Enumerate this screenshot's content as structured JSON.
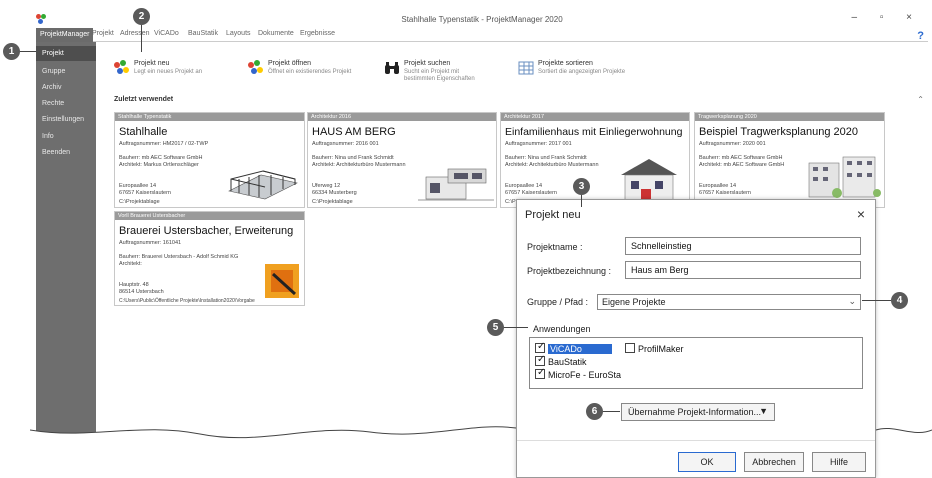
{
  "window": {
    "title": "Stahlhalle Typenstatik - ProjektManager 2020",
    "help": "?"
  },
  "ribbon": {
    "tabs": [
      "ProjektManager",
      "Projekt",
      "Adressen",
      "ViCADo",
      "BauStatik",
      "Layouts",
      "Dokumente",
      "Ergebnisse"
    ]
  },
  "sidebar": {
    "items": [
      "Projekt",
      "Gruppe",
      "Archiv",
      "Rechte",
      "Einstellungen",
      "Info",
      "Beenden"
    ]
  },
  "actions": [
    {
      "label": "Projekt neu",
      "sub": "Legt ein neues Projekt an"
    },
    {
      "label": "Projekt öffnen",
      "sub": "Öffnet ein existierendes Projekt"
    },
    {
      "label": "Projekt suchen",
      "sub": "Sucht ein Projekt mit bestimmten Eigenschaften"
    },
    {
      "label": "Projekte sortieren",
      "sub": "Sortiert die angezeigten Projekte"
    }
  ],
  "recent_header": "Zuletzt verwendet",
  "cards": [
    {
      "cap": "Stahlhalle Typenstatik",
      "name": "Stahlhalle",
      "num": "Auftragsnummer: HM2017 / 02-TWP",
      "l1": "Bauherr:   mb AEC Software GmbH",
      "l2": "Architekt:  Markus Ortlenschläger",
      "l3": "Europaallee 14",
      "l4": "67657 Kaiserslautern",
      "l5": "C:\\Projektablage"
    },
    {
      "cap": "Architektur 2016",
      "name": "HAUS AM BERG",
      "num": "Auftragsnummer: 2016 001",
      "l1": "Bauherr:   Nina und Frank Schmidt",
      "l2": "Architekt:  Architekturbüro Mustermann",
      "l3": "Uferweg 12",
      "l4": "66334 Musterberg",
      "l5": "C:\\Projektablage"
    },
    {
      "cap": "Architektur 2017",
      "name": "Einfamilienhaus mit Einliegerwohnung",
      "num": "Auftragsnummer: 2017 001",
      "l1": "Bauherr:   Nina und Frank Schmidt",
      "l2": "Architekt:  Architekturbüro Mustermann",
      "l3": "Europaallee 14",
      "l4": "67657 Kaiserslautern",
      "l5": "C:\\Projektablage"
    },
    {
      "cap": "Tragwerksplanung 2020",
      "name": "Beispiel Tragwerksplanung 2020",
      "num": "Auftragsnummer: 2020 001",
      "l1": "Bauherr:   mb AEC Software GmbH",
      "l2": "Architekt:  mb AEC Software GmbH",
      "l3": "Europaallee 14",
      "l4": "67657 Kaiserslautern",
      "l5": ""
    },
    {
      "cap": "Vorll Brauerei Ustersbacher",
      "name": "Brauerei Ustersbacher, Erweiterung",
      "num": "Auftragsnummer: 161041",
      "l1": "Bauherr:   Brauerei Ustersbach - Adolf Schmid KG",
      "l2": "Architekt:",
      "l3": "Hauptstr. 48",
      "l4": "86514 Ustersbach",
      "l5": "C:\\Users\\Public\\Öffentliche Projekte\\Installation2020\\Vorgabe"
    }
  ],
  "dialog": {
    "title": "Projekt neu",
    "close": "×",
    "name_label": "Projektname :",
    "name_value": "Schnelleinstieg",
    "desc_label": "Projektbezeichnung :",
    "desc_value": "Haus am Berg",
    "group_label": "Gruppe / Pfad :",
    "group_value": "Eigene Projekte",
    "apps_label": "Anwendungen",
    "apps": [
      {
        "label": "ViCADo",
        "checked": true
      },
      {
        "label": "BauStatik",
        "checked": true
      },
      {
        "label": "MicroFe - EuroSta",
        "checked": true
      },
      {
        "label": "ProfilMaker",
        "checked": false
      }
    ],
    "transfer_button": "Übernahme Projekt-Information...",
    "ok": "OK",
    "cancel": "Abbrechen",
    "help": "Hilfe"
  },
  "callouts": [
    "1",
    "2",
    "3",
    "4",
    "5",
    "6"
  ],
  "colors": {
    "sidebar": "#6e6e6e",
    "accent": "#2a6ad0",
    "callout": "#5a5a5a"
  }
}
